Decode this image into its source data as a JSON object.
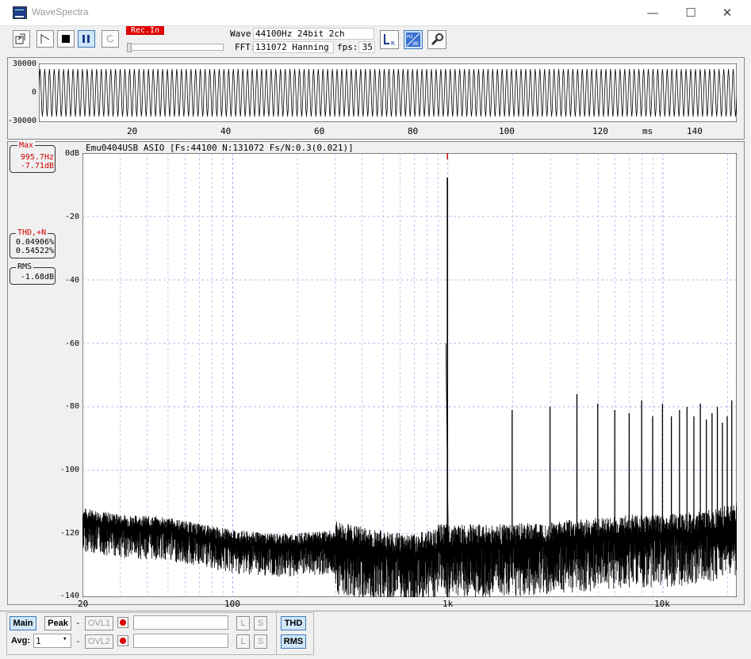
{
  "window": {
    "title": "WaveSpectra",
    "minimize": "—",
    "maximize": "☐",
    "close": "✕"
  },
  "toolbar": {
    "rec_badge": "Rec.In",
    "wave_label": "Wave:",
    "wave_value": "44100Hz 24bit 2ch",
    "fft_label": "FFT:",
    "fft_value": "131072 Hanning",
    "fps_label": "fps:",
    "fps_value": "35",
    "lr_icon": "LR",
    "hz_db_icon": "Hz dB"
  },
  "wave": {
    "y_labels": [
      "30000",
      "0",
      "-30000"
    ],
    "x_labels": [
      "20",
      "40",
      "60",
      "80",
      "100",
      "120",
      "140"
    ],
    "x_unit": "ms"
  },
  "spectrum": {
    "header": "Emu0404USB ASIO  [Fs:44100 N:131072 Fs/N:0.3(0.021)]",
    "y_labels": [
      "0dB",
      "-20",
      "-40",
      "-60",
      "-80",
      "-100",
      "-120",
      "-140"
    ],
    "x_labels": [
      "20",
      "100",
      "1k",
      "10k"
    ],
    "max_title": "Max",
    "max_freq": "995.7Hz",
    "max_level": "-7.71dB",
    "thd_title": "THD,+N",
    "thd_value": "0.04906%",
    "thdn_value": "0.54522%",
    "rms_title": "RMS",
    "rms_value": "-1.68dB"
  },
  "chart_data": {
    "type": "line",
    "x_scale": "log",
    "xlim": [
      20,
      22050
    ],
    "ylim": [
      -140,
      0
    ],
    "series": [
      {
        "x": [
          20,
          30,
          50,
          70,
          100,
          150,
          200,
          300,
          500,
          700,
          900,
          995.7,
          1100,
          1500,
          2000,
          3000,
          5000,
          7000,
          10000,
          15000,
          20000,
          22050
        ],
        "y": [
          -116,
          -118,
          -119,
          -121,
          -123,
          -124,
          -124,
          -123,
          -126,
          -127,
          -125,
          -7.71,
          -124,
          -124,
          -124,
          -123,
          -122,
          -121,
          -121,
          -120,
          -118,
          -117
        ]
      }
    ],
    "harmonics": [
      {
        "x": 1991,
        "y": -81
      },
      {
        "x": 2987,
        "y": -80
      },
      {
        "x": 3983,
        "y": -76
      },
      {
        "x": 4979,
        "y": -79
      },
      {
        "x": 5974,
        "y": -81
      },
      {
        "x": 6970,
        "y": -82
      },
      {
        "x": 7966,
        "y": -78
      },
      {
        "x": 8961,
        "y": -83
      },
      {
        "x": 9957,
        "y": -79
      },
      {
        "x": 10953,
        "y": -83
      },
      {
        "x": 11948,
        "y": -81
      },
      {
        "x": 12944,
        "y": -80
      },
      {
        "x": 13940,
        "y": -83
      },
      {
        "x": 14936,
        "y": -79
      },
      {
        "x": 15931,
        "y": -84
      },
      {
        "x": 16927,
        "y": -82
      },
      {
        "x": 17923,
        "y": -80
      },
      {
        "x": 18918,
        "y": -85
      },
      {
        "x": 19914,
        "y": -83
      },
      {
        "x": 20910,
        "y": -78
      }
    ],
    "grid": true
  },
  "bottom": {
    "main": "Main",
    "peak": "Peak",
    "dash": "-",
    "ovl1": "OVL1",
    "ovl2": "OVL2",
    "l": "L",
    "s": "S",
    "thd": "THD",
    "rms": "RMS",
    "avg_label": "Avg:",
    "avg_value": "1"
  }
}
